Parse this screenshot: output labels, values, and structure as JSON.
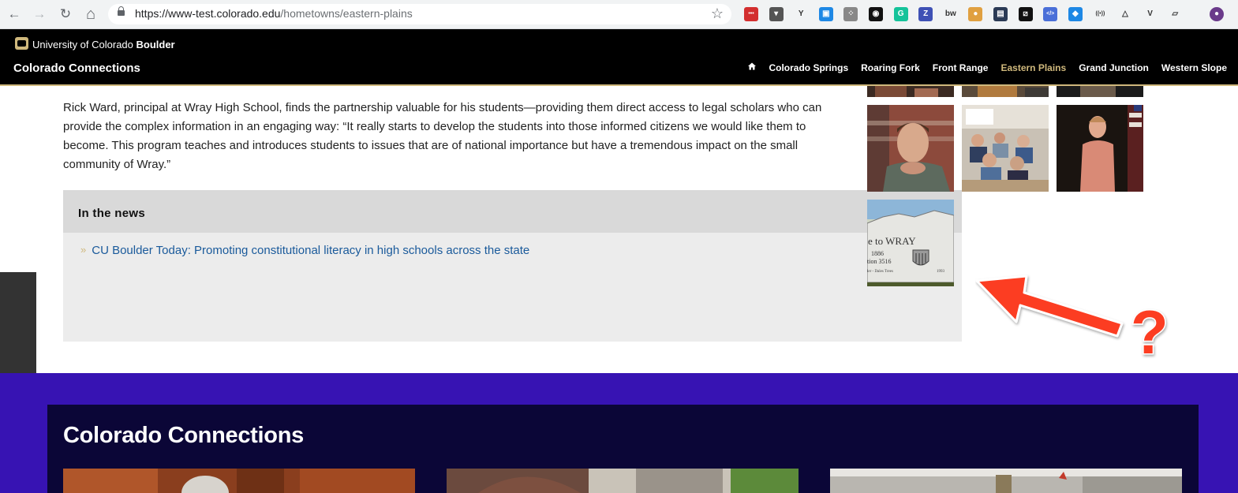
{
  "browser": {
    "url_host": "https://www-test.colorado.edu",
    "url_path": "/hometowns/eastern-plains",
    "nav": {
      "back": "←",
      "forward": "→",
      "reload": "↻",
      "home": "⌂"
    },
    "bookmark_icon": "star-icon",
    "extensions": [
      {
        "name": "lastpass-ext-icon",
        "glyph": "•••",
        "color": "#d32f2f"
      },
      {
        "name": "pocket-ext-icon",
        "glyph": "▾",
        "color": "#555555"
      },
      {
        "name": "ycombinator-ext-icon",
        "glyph": "Y",
        "color": "#ffffff"
      },
      {
        "name": "window-ext-icon",
        "glyph": "▣",
        "color": "#1e88e5"
      },
      {
        "name": "dots-ext-icon",
        "glyph": "⁘",
        "color": "#888888"
      },
      {
        "name": "eye-ext-icon",
        "glyph": "◉",
        "color": "#111111"
      },
      {
        "name": "grammarly-ext-icon",
        "glyph": "G",
        "color": "#15c39a"
      },
      {
        "name": "zotero-ext-icon",
        "glyph": "Z",
        "color": "#3f51b5"
      },
      {
        "name": "bw-ext-icon",
        "glyph": "bw",
        "color": "#ffffff"
      },
      {
        "name": "cookie-ext-icon",
        "glyph": "●",
        "color": "#e0a040"
      },
      {
        "name": "screen-ext-icon",
        "glyph": "▤",
        "color": "#2b3a55"
      },
      {
        "name": "slash-ext-icon",
        "glyph": "⧄",
        "color": "#111111"
      },
      {
        "name": "code-ext-icon",
        "glyph": "</>",
        "color": "#4a6fd8"
      },
      {
        "name": "drupal-ext-icon",
        "glyph": "◆",
        "color": "#1e88e5"
      },
      {
        "name": "broadcast-ext-icon",
        "glyph": "((•))",
        "color": "#ffffff"
      },
      {
        "name": "triangle-ext-icon",
        "glyph": "△",
        "color": "#ffffff"
      },
      {
        "name": "v-ext-icon",
        "glyph": "V",
        "color": "#ffffff"
      },
      {
        "name": "card-ext-icon",
        "glyph": "▱",
        "color": "#ffffff"
      },
      {
        "name": "profile-avatar-icon",
        "glyph": "●",
        "color": "#6a3a8a"
      }
    ]
  },
  "header": {
    "university_prefix": "University of Colorado ",
    "university_bold": "Boulder",
    "site_name": "Colorado Connections",
    "nav": [
      {
        "label": "Colorado Springs",
        "active": false
      },
      {
        "label": "Roaring Fork",
        "active": false
      },
      {
        "label": "Front Range",
        "active": false
      },
      {
        "label": "Eastern Plains",
        "active": true
      },
      {
        "label": "Grand Junction",
        "active": false
      },
      {
        "label": "Western Slope",
        "active": false
      }
    ],
    "accent": "#cfb87c"
  },
  "main": {
    "quote": "Rick Ward, principal at Wray High School, finds the partnership valuable for his students—providing them direct access to legal scholars who can provide the complex information in an engaging way: “It really starts to develop the students into those informed citizens we would like them to become. This program teaches and introduces students to issues that are of national importance but have a tremendous impact on the small community of Wray.”",
    "news": {
      "heading": "In the news",
      "items": [
        "CU Boulder Today: Promoting constitutional literacy in high schools across the state"
      ]
    },
    "sign_text": {
      "line1": "e to WRAY",
      "line2": "1886",
      "line3": "tion 3516",
      "line4": "ler - Dales Trees",
      "line5": "1993"
    }
  },
  "annotation": {
    "mark": "?",
    "color": "#fc3d21"
  },
  "footer": {
    "title": "Colorado Connections",
    "colors": {
      "band": "#3713b3",
      "panel": "#0b0637"
    }
  }
}
